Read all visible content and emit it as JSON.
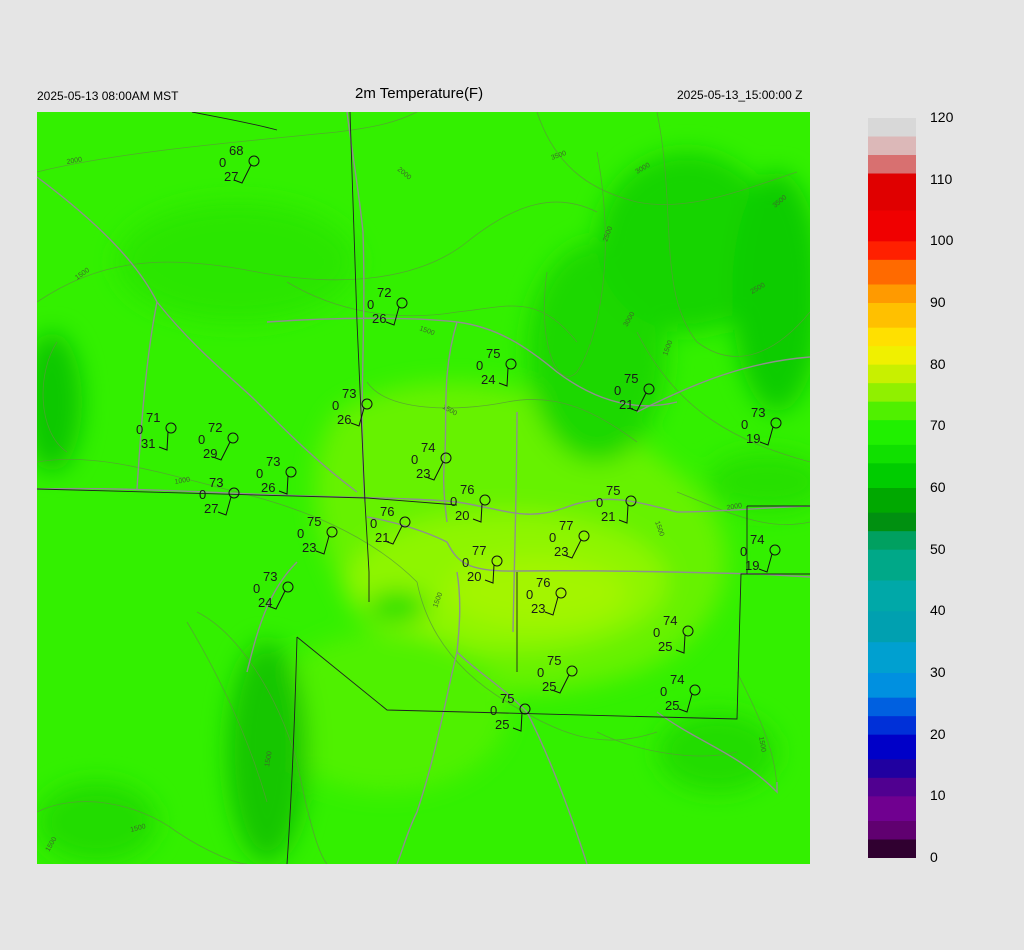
{
  "header": {
    "local_time": "2025-05-13 08:00AM MST",
    "title": "2m Temperature(F)",
    "utc_time": "2025-05-13_15:00:00 Z"
  },
  "colorbar": {
    "labels": [
      "120",
      "110",
      "100",
      "90",
      "80",
      "70",
      "60",
      "50",
      "40",
      "30",
      "20",
      "10",
      "0"
    ],
    "min": 0,
    "max": 120
  },
  "contours": [
    "2000",
    "2000",
    "3000",
    "3500",
    "3500",
    "2500",
    "3000",
    "2500",
    "2000",
    "1500",
    "1500",
    "1500",
    "1500",
    "2000",
    "1500",
    "1000",
    "1500",
    "1500",
    "1500",
    "1500",
    "1500",
    "1500"
  ],
  "stations": [
    {
      "t": "68",
      "w": "0",
      "d": "27"
    },
    {
      "t": "72",
      "w": "0",
      "d": "26"
    },
    {
      "t": "75",
      "w": "0",
      "d": "24"
    },
    {
      "t": "75",
      "w": "0",
      "d": "21"
    },
    {
      "t": "73",
      "w": "0",
      "d": "19"
    },
    {
      "t": "71",
      "w": "0",
      "d": "31"
    },
    {
      "t": "72",
      "w": "0",
      "d": "29"
    },
    {
      "t": "73",
      "w": "0",
      "d": "26"
    },
    {
      "t": "73",
      "w": "0",
      "d": "26"
    },
    {
      "t": "74",
      "w": "0",
      "d": "23"
    },
    {
      "t": "73",
      "w": "0",
      "d": "27"
    },
    {
      "t": "76",
      "w": "0",
      "d": "20"
    },
    {
      "t": "76",
      "w": "0",
      "d": "21"
    },
    {
      "t": "75",
      "w": "0",
      "d": "23"
    },
    {
      "t": "75",
      "w": "0",
      "d": "21"
    },
    {
      "t": "77",
      "w": "0",
      "d": "23"
    },
    {
      "t": "74",
      "w": "0",
      "d": "19"
    },
    {
      "t": "77",
      "w": "0",
      "d": "20"
    },
    {
      "t": "73",
      "w": "0",
      "d": "24"
    },
    {
      "t": "76",
      "w": "0",
      "d": "23"
    },
    {
      "t": "74",
      "w": "0",
      "d": "25"
    },
    {
      "t": "75",
      "w": "0",
      "d": "25"
    },
    {
      "t": "74",
      "w": "0",
      "d": "25"
    },
    {
      "t": "75",
      "w": "0",
      "d": "25"
    }
  ]
}
